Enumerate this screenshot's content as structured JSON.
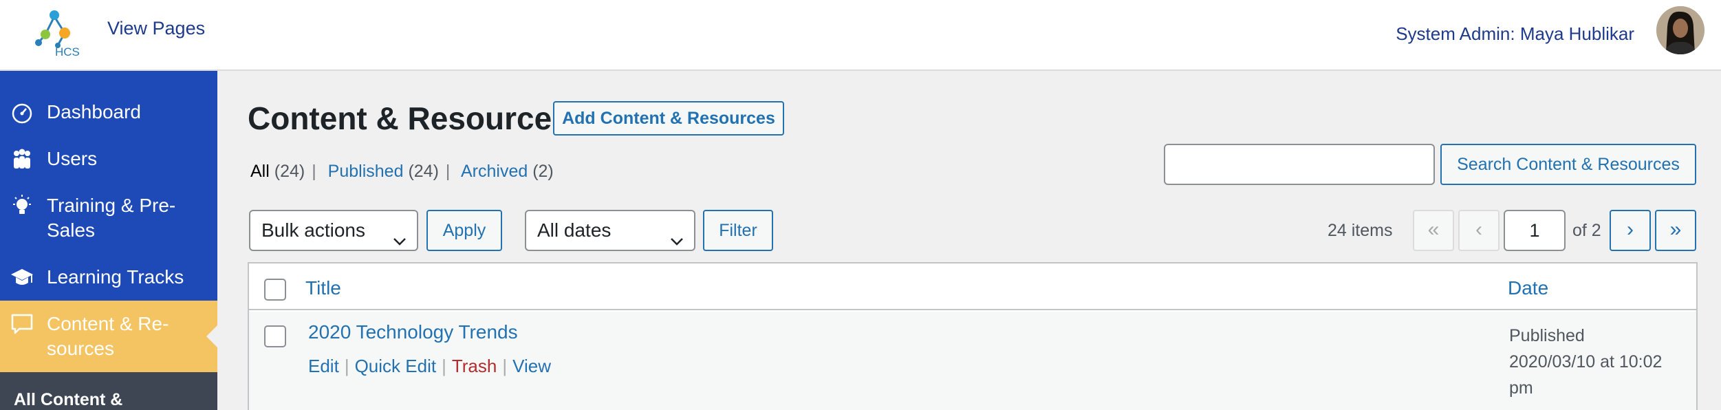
{
  "topbar": {
    "logo_text": "HCS",
    "view_pages": "View Pages",
    "user_label": "System Admin: Maya Hublikar"
  },
  "sidebar": {
    "items": [
      {
        "label": "Dashboard",
        "icon": "dashboard-gauge-icon"
      },
      {
        "label": "Users",
        "icon": "users-group-icon"
      },
      {
        "label": "Training & Pre-Sales",
        "icon": "lightbulb-icon"
      },
      {
        "label": "Learning Tracks",
        "icon": "graduation-cap-icon"
      },
      {
        "label": "Content & Re-sources",
        "icon": "speech-bubble-icon",
        "active": true
      }
    ],
    "submenu_label": "All Content &"
  },
  "main": {
    "title": "Content & Resources",
    "add_button": "Add Content & Resources",
    "views": {
      "all": "All",
      "all_count": "(24)",
      "published": "Published",
      "published_count": "(24)",
      "archived": "Archived",
      "archived_count": "(2)"
    },
    "search_button": "Search Content & Resources",
    "bulk_select": "Bulk actions",
    "apply_button": "Apply",
    "dates_select": "All dates",
    "filter_button": "Filter",
    "pagination": {
      "items": "24 items",
      "first": "«",
      "prev": "‹",
      "current_page": "1",
      "of": "of 2",
      "next": "›",
      "last": "»"
    },
    "table": {
      "columns": {
        "title": "Title",
        "date": "Date"
      },
      "rows": [
        {
          "title": "2020 Technology Trends",
          "actions": {
            "edit": "Edit",
            "quick_edit": "Quick Edit",
            "trash": "Trash",
            "view": "View"
          },
          "status": "Published",
          "date": "2020/03/10 at 10:02 pm"
        }
      ]
    }
  },
  "colors": {
    "sidebar_bg": "#1e4ab8",
    "active_item": "#f5c462",
    "link": "#2271b1",
    "trash": "#b32d2e"
  }
}
